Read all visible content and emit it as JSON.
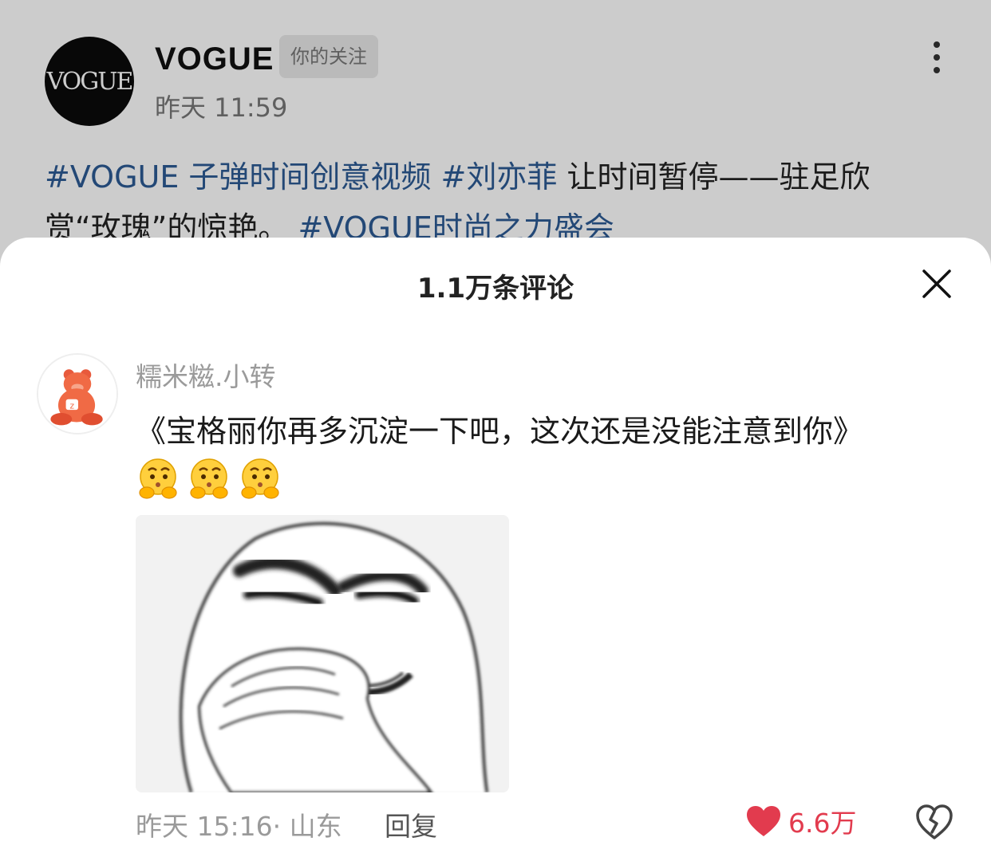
{
  "post": {
    "author": "VOGUE",
    "avatar_logo": "VOGUE",
    "follow_badge": "你的关注",
    "time": "昨天 11:59",
    "text": {
      "tag1": "#VOGUE 子弹时间创意视频",
      "tag2": "#刘亦菲",
      "body": " 让时间暂停——驻足欣赏“玫瑰”的惊艳。",
      "tag3": "#VOGUE时尚之力盛会"
    },
    "more_icon": "more-vertical-icon"
  },
  "sheet": {
    "title": "1.1万条评论",
    "close_icon": "close-icon"
  },
  "comment": {
    "username": "糯米糍.小转",
    "text": "《宝格丽你再多沉淀一下吧，这次还是没能注意到你》",
    "emojis": [
      "thinking-face-icon",
      "thinking-face-icon",
      "thinking-face-icon"
    ],
    "image": "meme-face-image",
    "time_location": "昨天 15:16· 山东",
    "reply_label": "回复",
    "like_count": "6.6万",
    "colors": {
      "like": "#e23b4e",
      "hashtag": "#2c5a94"
    }
  }
}
